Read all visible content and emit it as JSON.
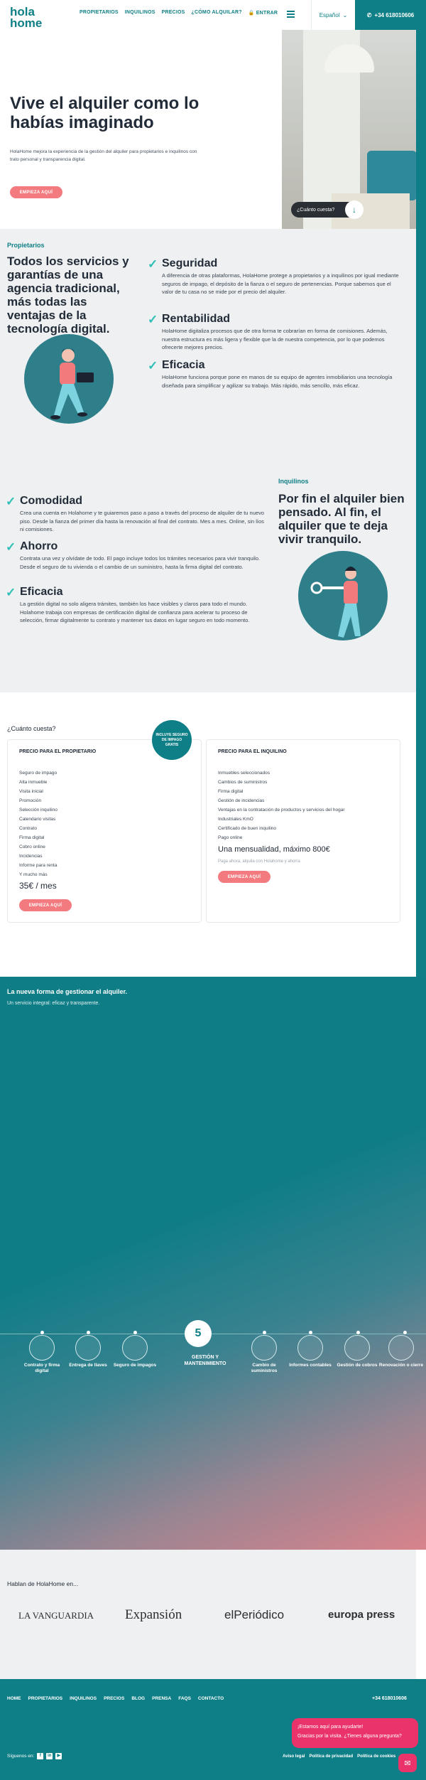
{
  "header": {
    "logo": "hola home",
    "nav": [
      "PROPIETARIOS",
      "INQUILINOS",
      "PRECIOS",
      "¿CÓMO ALQUILAR?",
      "ENTRAR"
    ],
    "language": "Español",
    "phone": "+34 618010606"
  },
  "hero": {
    "title": "Vive el alquiler como lo habías imaginado",
    "text": "HolaHome mejora la experiencia de la gestión del alquiler para propietarios e inquilinos con trato personal y transparencia digital.",
    "cta": "EMPIEZA AQUÍ",
    "image_pill": "¿Cuánto cuesta?"
  },
  "owners": {
    "tag": "Propietarios",
    "heading": "Todos los servicios y garantías de una agencia tradicional, más todas las ventajas de la tecnología digital.",
    "features": [
      {
        "title": "Seguridad",
        "text": "A diferencia de otras plataformas, HolaHome protege a propietarios y a inquilinos por igual mediante seguros de impago, el depósito de la fianza o el seguro de pertenencias. Porque sabemos que el valor de tu casa no se mide por el precio del alquiler."
      },
      {
        "title": "Rentabilidad",
        "text": "HolaHome digitaliza procesos que de otra forma te cobrarían en forma de comisiones. Además, nuestra estructura es más ligera y flexible que la de nuestra competencia, por lo que podemos ofrecerte mejores precios."
      },
      {
        "title": "Eficacia",
        "text": "HolaHome funciona porque pone en manos de su equipo de agentes inmobiliarios una tecnología diseñada para simplificar y agilizar su trabajo. Más rápido, más sencillo, más eficaz."
      }
    ]
  },
  "tenants": {
    "tag": "Inquilinos",
    "heading": "Por fin el alquiler bien pensado. Al fin, el alquiler que te deja vivir tranquilo.",
    "features": [
      {
        "title": "Comodidad",
        "text": "Crea una cuenta en Holahome y te guiaremos paso a paso a través del proceso de alquiler de tu nuevo piso. Desde la fianza del primer día hasta la renovación al final del contrato. Mes a mes. Online, sin líos ni comisiones."
      },
      {
        "title": "Ahorro",
        "text": "Contrata una vez y olvídate de todo. El pago incluye todos los trámites necesarios para vivir tranquilo. Desde el seguro de tu vivienda o el cambio de un suministro, hasta la firma digital del contrato."
      },
      {
        "title": "Eficacia",
        "text": "La gestión digital no solo aligera trámites, también los hace visibles y claros para todo el mundo. Holahome trabaja con empresas de certificación digital de confianza para acelerar tu proceso de selección, firmar digitalmente tu contrato y mantener tus datos en lugar seguro en todo momento."
      }
    ]
  },
  "pricing": {
    "question": "¿Cuánto cuesta?",
    "badge": "INCLUYE SEGURO DE IMPAGO GRATIS",
    "owner": {
      "title": "PRECIO PARA EL PROPIETARIO",
      "items": [
        "Seguro de impago",
        "Alta inmueble",
        "Visita inicial",
        "Promoción",
        "Selección inquilino",
        "Calendario visitas",
        "Contrato",
        "Firma digital",
        "Cobro online",
        "Incidencias",
        "Informe para renta",
        "Y mucho más"
      ],
      "price": "35€ / mes",
      "cta": "EMPIEZA AQUÍ"
    },
    "tenant": {
      "title": "PRECIO PARA EL INQUILINO",
      "items": [
        "Inmuebles seleccionados",
        "Cambios de suministros",
        "Firma digital",
        "Gestión de incidencias",
        "Ventajas en la contratación de productos y servicios del hogar",
        "Industriales KmO",
        "Certificado de buen inquilino",
        "Pago online"
      ],
      "price": "Una mensualidad, máximo 800€",
      "note": "Paga ahora, alquila con Holahome y ahorra",
      "cta": "EMPIEZA AQUÍ"
    }
  },
  "process": {
    "title": "La nueva forma de gestionar el alquiler.",
    "subtitle": "Un servicio integral: eficaz y transparente.",
    "current_step": "5",
    "current_title": "GESTIÓN Y MANTENIMIENTO",
    "steps": [
      "Contrato y firma digital",
      "Entrega de llaves",
      "Seguro de impagos",
      "Cambio de suministros",
      "Informes contables",
      "Gestión de cobros",
      "Renovación o cierre"
    ]
  },
  "press": {
    "title": "Hablan de HolaHome en...",
    "logos": [
      "LA VANGUARDIA",
      "Expansión",
      "elPeriódico",
      "europa press"
    ]
  },
  "footer": {
    "nav": [
      "HOME",
      "PROPIETARIOS",
      "INQUILINOS",
      "PRECIOS",
      "BLOG",
      "PRENSA",
      "FAQS",
      "CONTACTO"
    ],
    "phone": "+34 618010606",
    "social_label": "Síguenos en:",
    "legal": [
      "Aviso legal",
      "Política de privacidad",
      "Política de cookies"
    ]
  },
  "chat": {
    "line1": "¡Estamos aquí para ayudarte!",
    "line2": "Gracias por la visita. ¿Tienes alguna pregunta?"
  }
}
